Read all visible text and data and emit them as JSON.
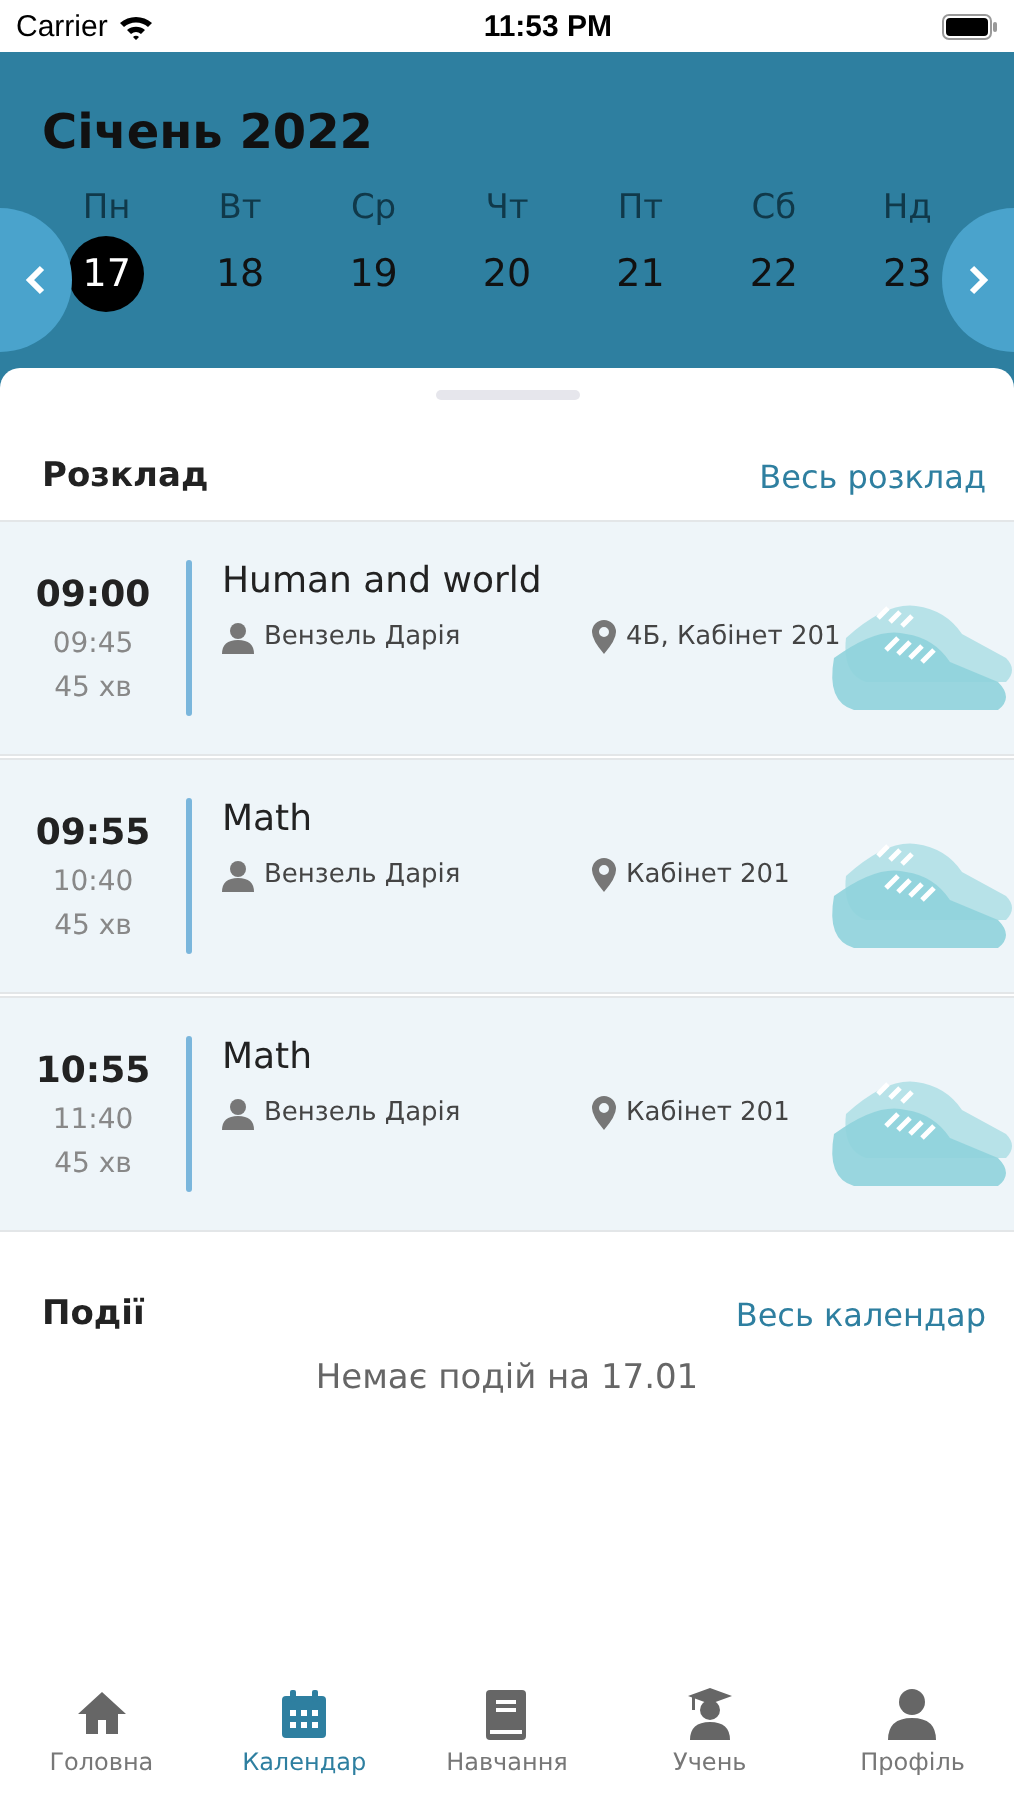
{
  "status_bar": {
    "carrier": "Carrier",
    "time": "11:53 PM"
  },
  "header": {
    "month": "Січень 2022",
    "days": [
      {
        "weekday": "Пн",
        "date": "17",
        "selected": true
      },
      {
        "weekday": "Вт",
        "date": "18",
        "selected": false
      },
      {
        "weekday": "Ср",
        "date": "19",
        "selected": false
      },
      {
        "weekday": "Чт",
        "date": "20",
        "selected": false
      },
      {
        "weekday": "Пт",
        "date": "21",
        "selected": false
      },
      {
        "weekday": "Сб",
        "date": "22",
        "selected": false
      },
      {
        "weekday": "Нд",
        "date": "23",
        "selected": false
      }
    ]
  },
  "schedule": {
    "title": "Розклад",
    "link": "Весь розклад",
    "lessons": [
      {
        "start": "09:00",
        "end": "09:45",
        "duration": "45 хв",
        "subject": "Human and world",
        "teacher": "Вензель Дарія",
        "room": "4Б, Кабінет 201"
      },
      {
        "start": "09:55",
        "end": "10:40",
        "duration": "45 хв",
        "subject": "Math",
        "teacher": "Вензель Дарія",
        "room": "Кабінет 201"
      },
      {
        "start": "10:55",
        "end": "11:40",
        "duration": "45 хв",
        "subject": "Math",
        "teacher": "Вензель Дарія",
        "room": "Кабінет 201"
      }
    ]
  },
  "events": {
    "title": "Події",
    "link": "Весь календар",
    "empty": "Немає подій на 17.01"
  },
  "tab_bar": [
    {
      "kind": "home",
      "label": "Головна",
      "selected": false
    },
    {
      "kind": "calendar",
      "label": "Календар",
      "selected": true
    },
    {
      "kind": "book",
      "label": "Навчання",
      "selected": false
    },
    {
      "kind": "student",
      "label": "Учень",
      "selected": false
    },
    {
      "kind": "profile",
      "label": "Профіль",
      "selected": false
    }
  ]
}
